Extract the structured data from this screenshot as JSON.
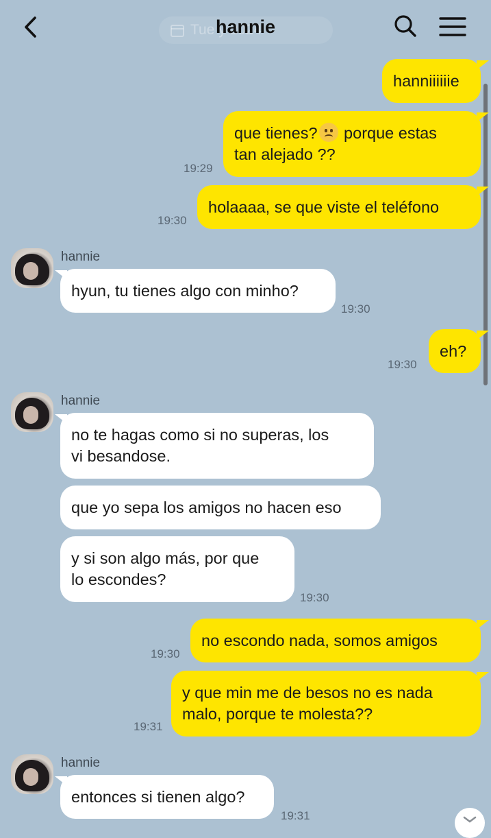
{
  "header": {
    "title": "hannie",
    "date_pill": "Tue          y 2024"
  },
  "messages": {
    "m1": {
      "text": "hanniiiiiie"
    },
    "m2": {
      "line1": "que tienes?",
      "line1b": " porque estas",
      "line2": "tan alejado ??",
      "time": "19:29",
      "emoji": "frowning-face"
    },
    "m3": {
      "text": "holaaaa, se que viste el teléfono",
      "time": "19:30"
    },
    "m4": {
      "sender": "hannie",
      "text": "hyun, tu tienes algo con minho?",
      "time": "19:30"
    },
    "m5": {
      "text": "eh?",
      "time": "19:30"
    },
    "m6": {
      "sender": "hannie",
      "line1": "no te hagas como si no superas, los",
      "line2": "vi besandose."
    },
    "m7": {
      "text": "que yo sepa los amigos no hacen eso"
    },
    "m8": {
      "line1": "y si son algo más, por que",
      "line2": "lo escondes?",
      "time": "19:30"
    },
    "m9": {
      "text": "no escondo nada, somos amigos",
      "time": "19:30"
    },
    "m10": {
      "line1": "y que min me de besos no es nada",
      "line2": "malo, porque te molesta??",
      "time": "19:31"
    },
    "m11": {
      "sender": "hannie",
      "text": "entonces si tienen algo?",
      "time": "19:31"
    }
  },
  "colors": {
    "background": "#acc1d2",
    "outgoing_bubble": "#fee500",
    "incoming_bubble": "#ffffff"
  }
}
